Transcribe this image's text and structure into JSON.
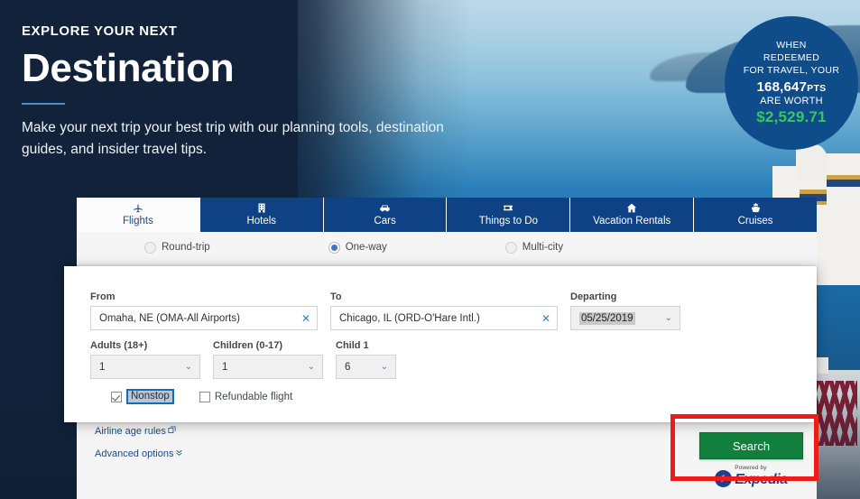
{
  "hero": {
    "eyebrow": "EXPLORE YOUR NEXT",
    "title": "Destination",
    "subtitle": "Make your next trip your best trip with our planning tools, destination guides, and insider travel tips."
  },
  "points_badge": {
    "line1": "WHEN",
    "line2": "REDEEMED",
    "line3": "FOR TRAVEL, YOUR",
    "points": "168,647",
    "points_unit": "PTS",
    "worth_label": "ARE WORTH",
    "value": "$2,529.71",
    "bg_color": "#0f4c8a",
    "value_color": "#38c75f"
  },
  "widget": {
    "tabs": [
      {
        "label": "Flights",
        "icon": "airplane-icon",
        "active": true
      },
      {
        "label": "Hotels",
        "icon": "building-icon",
        "active": false
      },
      {
        "label": "Cars",
        "icon": "car-icon",
        "active": false
      },
      {
        "label": "Things to Do",
        "icon": "ticket-icon",
        "active": false
      },
      {
        "label": "Vacation Rentals",
        "icon": "house-icon",
        "active": false
      },
      {
        "label": "Cruises",
        "icon": "ship-icon",
        "active": false
      }
    ],
    "trip_types": [
      {
        "label": "Round-trip",
        "selected": false
      },
      {
        "label": "One-way",
        "selected": true
      },
      {
        "label": "Multi-city",
        "selected": false
      }
    ],
    "form": {
      "from_label": "From",
      "from_value": "Omaha, NE (OMA-All Airports)",
      "to_label": "To",
      "to_value": "Chicago, IL (ORD-O'Hare Intl.)",
      "departing_label": "Departing",
      "departing_value": "05/25/2019",
      "adults_label": "Adults (18+)",
      "adults_value": "1",
      "children_label": "Children (0-17)",
      "children_value": "1",
      "child1_label": "Child 1",
      "child1_value": "6",
      "nonstop_label": "Nonstop",
      "nonstop_checked": true,
      "refundable_label": "Refundable flight",
      "refundable_checked": false,
      "clear_icon": "✕",
      "chevron_icon": "⌄"
    },
    "links": [
      {
        "label": "Airline age rules",
        "icon": "external-link-icon"
      },
      {
        "label": "Advanced options",
        "icon": "chevron-double-down-icon"
      }
    ],
    "search_button": "Search",
    "expedia": {
      "powered_by": "Powered by",
      "brand": "Expedia",
      "icon": "expedia-logo-icon"
    }
  },
  "annotation": {
    "color": "#ee1b1b",
    "target": "search-button"
  }
}
